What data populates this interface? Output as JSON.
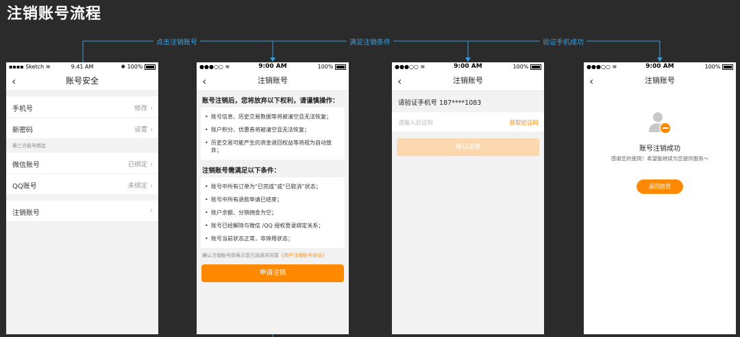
{
  "page_title": "注销账号流程",
  "flow_labels": [
    "点击注销账号",
    "满足注销条件",
    "验证手机成功"
  ],
  "colors": {
    "accent": "#ff8a00",
    "flow": "#3aa0e0",
    "background": "#2b2b2b"
  },
  "screen1": {
    "status": {
      "carrier": "Sketch",
      "time": "9:41 AM",
      "battery": "100%"
    },
    "nav_title": "账号安全",
    "rows": [
      {
        "label": "手机号",
        "value": "修改"
      },
      {
        "label": "新密码",
        "value": "设置"
      }
    ],
    "section_title": "第三方账号绑定",
    "third_party": [
      {
        "label": "微信账号",
        "value": "已绑定"
      },
      {
        "label": "QQ账号",
        "value": "未绑定"
      }
    ],
    "cancel_row": {
      "label": "注销账号",
      "value": ""
    }
  },
  "screen2": {
    "status": {
      "carrier": "●●●○○",
      "time": "9:00 AM",
      "battery": "100%"
    },
    "nav_title": "注销账号",
    "heading1": "账号注销后，您将放弃以下权利，请谨慎操作：",
    "rights": [
      "账号信息、历史交易数据等将被清空且无法恢复；",
      "账户积分、优惠券将被清空且无法恢复；",
      "历史交易可能产生的资金退回权益等将视为自动放弃；"
    ],
    "heading2": "注销账号需满足以下条件：",
    "conditions": [
      "账号中所有订单为“已完成”或“已取消”状态；",
      "账号中所有退款申请已结束；",
      "账户余额、分销佣金为空；",
      "账号已经解除与微信 /QQ 授权登录绑定关系；",
      "账号当前状态正常，非停用状态；"
    ],
    "agree_text": "确认注销账号即表示您已阅读并同意",
    "agree_link": "《用户注销账号协议》",
    "apply_button": "申请注销"
  },
  "screen3": {
    "status": {
      "carrier": "●●●○○",
      "time": "9:00 AM",
      "battery": "100%"
    },
    "nav_title": "注销账号",
    "verify_text": "请验证手机号 187****1083",
    "code_placeholder": "请输入验证码",
    "get_code": "获取验证码",
    "confirm_button": "确认注销"
  },
  "screen4": {
    "status": {
      "carrier": "●●●○○",
      "time": "9:00 AM",
      "battery": "100%"
    },
    "nav_title": "注销账号",
    "success_title": "账号注销成功",
    "success_sub": "感谢您的使用！希望能继续为您提供服务～",
    "home_button": "返回首页"
  }
}
